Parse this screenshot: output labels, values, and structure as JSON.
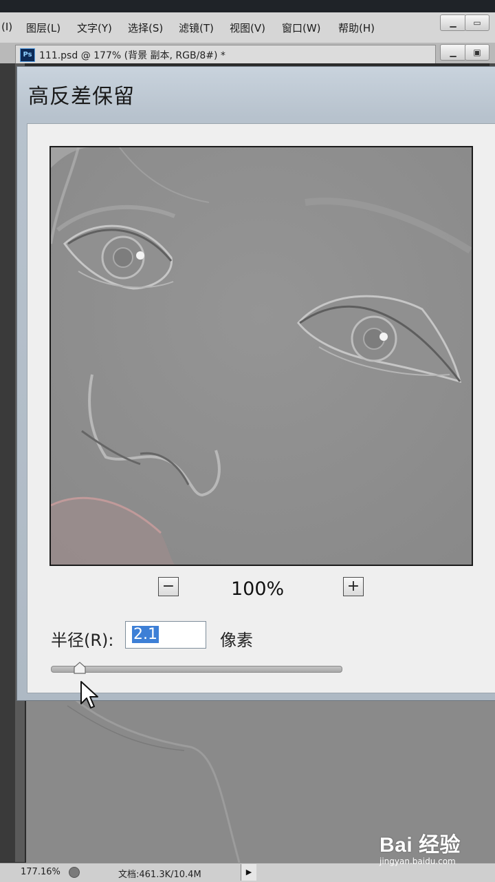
{
  "menubar": {
    "items": [
      "(I)",
      "图层(L)",
      "文字(Y)",
      "选择(S)",
      "滤镜(T)",
      "视图(V)",
      "窗口(W)",
      "帮助(H)"
    ]
  },
  "document": {
    "tab_title": "111.psd @ 177% (背景 副本, RGB/8#) *",
    "app_icon_text": "Ps"
  },
  "dialog": {
    "title": "高反差保留",
    "zoom_value": "100%",
    "zoom_out": "−",
    "zoom_in": "+",
    "radius_label": "半径(R):",
    "radius_value": "2.1",
    "radius_unit": "像素",
    "slider_fraction": 0.1
  },
  "status": {
    "zoom": "177.16%",
    "doc_size": "文档:461.3K/10.4M"
  },
  "watermark": {
    "logo": "Bai 经验",
    "url": "jingyan.baidu.com"
  },
  "colors": {
    "selection": "#3d7fd6",
    "dialog_title_bar": "#b7c2cd"
  }
}
